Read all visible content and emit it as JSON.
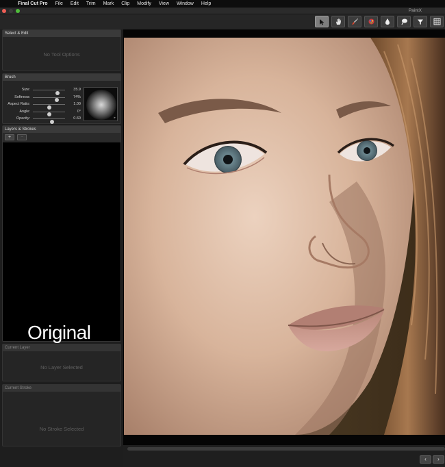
{
  "menubar": {
    "items": [
      "Final Cut Pro",
      "File",
      "Edit",
      "Trim",
      "Mark",
      "Clip",
      "Modify",
      "View",
      "Window",
      "Help"
    ]
  },
  "window": {
    "title": "PaintX"
  },
  "toolbar": {
    "tools": [
      "select-arrow-icon",
      "hand-icon",
      "brush-icon",
      "color-brush-icon",
      "drop-icon",
      "lasso-icon",
      "filter-icon",
      "grid-icon"
    ],
    "active_tool": "select-arrow-icon"
  },
  "select_edit": {
    "title": "Select & Edit",
    "placeholder": "No Tool Options"
  },
  "brush": {
    "title": "Brush",
    "params": [
      {
        "label": "Size:",
        "value": "35.9",
        "level": 0.76
      },
      {
        "label": "Softness:",
        "value": "74%",
        "level": 0.74
      },
      {
        "label": "Aspect Ratio:",
        "value": "1.00",
        "level": 0.5
      },
      {
        "label": "Angle:",
        "value": "0°",
        "level": 0.5
      },
      {
        "label": "Opacity:",
        "value": "0.60",
        "level": 0.6
      }
    ]
  },
  "layers": {
    "title": "Layers & Strokes",
    "add_label": "+",
    "remove_label": "−",
    "overlay_text": "Original"
  },
  "current_layer": {
    "title": "Current Layer",
    "placeholder": "No Layer Selected"
  },
  "current_stroke": {
    "title": "Current Stroke",
    "placeholder": "No Stroke Selected"
  },
  "navigation": {
    "prev_label": "‹",
    "next_label": "›"
  },
  "colors": {
    "accent_active": "#7d7d7d",
    "panel_header": "#3a3a3a"
  }
}
